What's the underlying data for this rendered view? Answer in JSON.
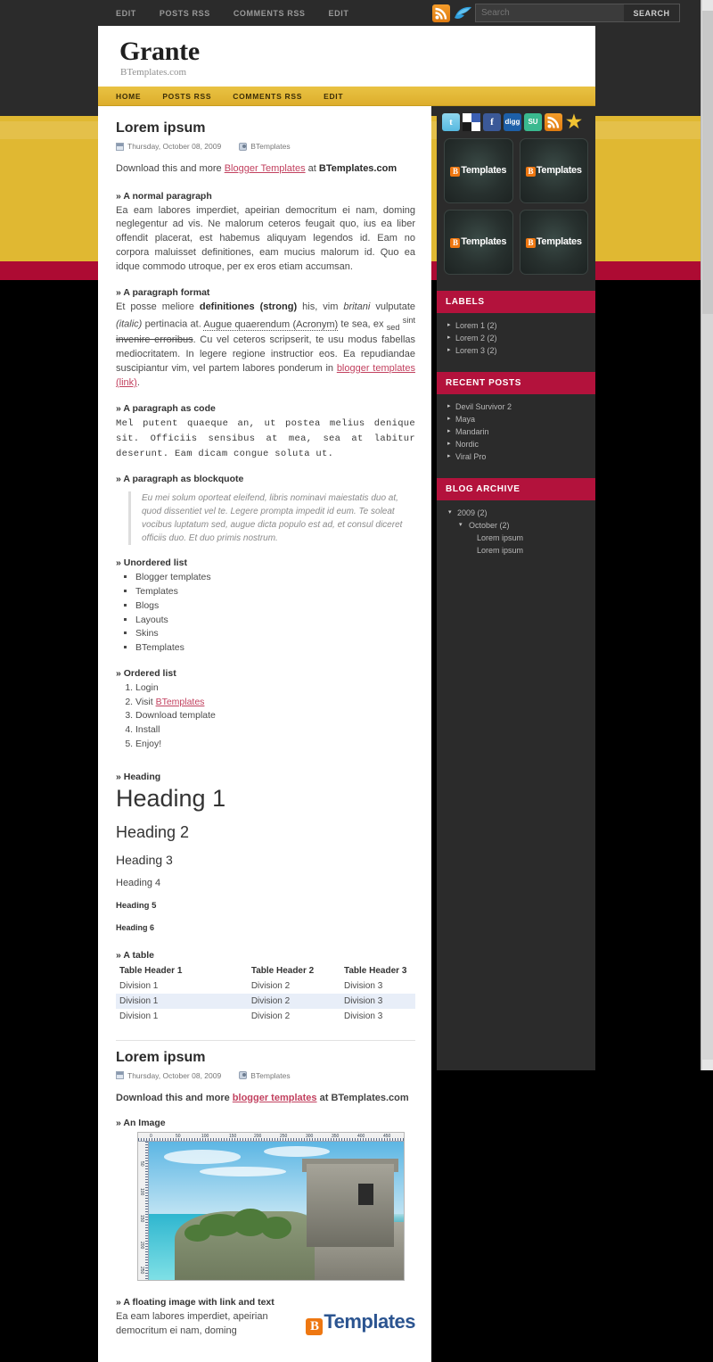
{
  "topbar": {
    "nav": [
      {
        "label": "EDIT"
      },
      {
        "label": "POSTS RSS"
      },
      {
        "label": "COMMENTS RSS"
      },
      {
        "label": "EDIT"
      }
    ],
    "icons": [
      {
        "name": "rss-icon"
      },
      {
        "name": "twitter-bird-icon"
      }
    ],
    "search": {
      "value": "",
      "placeholder": "Search",
      "button": "SEARCH"
    }
  },
  "header": {
    "title": "Grante",
    "description": "BTemplates.com"
  },
  "mainnav": [
    {
      "label": "HOME"
    },
    {
      "label": "POSTS RSS"
    },
    {
      "label": "COMMENTS RSS"
    },
    {
      "label": "EDIT"
    }
  ],
  "post1": {
    "title": "Lorem ipsum",
    "date": "Thursday, October 08, 2009",
    "author": "BTemplates",
    "download_pre": "Download this and more ",
    "download_link": "Blogger Templates",
    "download_mid": " at ",
    "download_site": "BTemplates.com",
    "normal_heading": "» A normal paragraph",
    "normal_text": "Ea eam labores imperdiet, apeirian democritum ei nam, doming neglegentur ad vis. Ne malorum ceteros feugait quo, ius ea liber offendit placerat, est habemus aliquyam legendos id. Eam no corpora maluisset definitiones, eam mucius malorum id. Quo ea idque commodo utroque, per ex eros etiam accumsan.",
    "format_heading": "» A paragraph format",
    "format_t1": "Et posse meliore ",
    "format_strong": "definitiones (strong)",
    "format_t2": " his, vim ",
    "format_italic1": "britani",
    "format_t3": " vulputate ",
    "format_italic2": "(italic)",
    "format_t4": " pertinacia at. ",
    "format_acronym": "Augue quaerendum (Acronym)",
    "format_t5": " te sea, ex ",
    "format_sub": "sed",
    "format_sup": "sint",
    "format_strike": "invenire erroribus",
    "format_t6": ". Cu vel ceteros scripserit, te usu modus fabellas mediocritatem. In legere regione instructior eos. Ea repudiandae suscipiantur vim, vel partem labores ponderum in ",
    "format_link": "blogger templates (link)",
    "format_t7": ".",
    "code_heading": "» A paragraph as code",
    "code_text": "Mel putent quaeque an, ut postea melius denique sit. Officiis sensibus at mea, sea at labitur deserunt. Eam dicam congue soluta ut.",
    "quote_heading": "» A paragraph as blockquote",
    "quote_text": "Eu mei solum oporteat eleifend, libris nominavi maiestatis duo at, quod dissentiet vel te. Legere prompta impedit id eum. Te soleat vocibus luptatum sed, augue dicta populo est ad, et consul diceret officiis duo. Et duo primis nostrum.",
    "ul_heading": "» Unordered list",
    "ul_items": [
      "Blogger templates",
      "Templates",
      "Blogs",
      "Layouts",
      "Skins",
      "BTemplates"
    ],
    "ol_heading": "» Ordered list",
    "ol_items": [
      "Login",
      "Visit BTemplates",
      "Download template",
      "Install",
      "Enjoy!"
    ],
    "ol_link_text": "BTemplates",
    "heading_label": "» Heading",
    "h1": "Heading 1",
    "h2": "Heading 2",
    "h3": "Heading 3",
    "h4": "Heading 4",
    "h5": "Heading 5",
    "h6": "Heading 6",
    "table_heading": "» A table",
    "table_headers": [
      "Table Header 1",
      "Table Header 2",
      "Table Header 3"
    ],
    "table_rows": [
      [
        "Division 1",
        "Division 2",
        "Division 3"
      ],
      [
        "Division 1",
        "Division 2",
        "Division 3"
      ],
      [
        "Division 1",
        "Division 2",
        "Division 3"
      ]
    ]
  },
  "post2": {
    "title": "Lorem ipsum",
    "date": "Thursday, October 08, 2009",
    "author": "BTemplates",
    "download_pre": "Download this and more ",
    "download_link": "blogger templates",
    "download_mid": " at ",
    "download_site": "BTemplates.com",
    "image_heading": "» An Image",
    "ruler_labels": [
      "0",
      "50",
      "100",
      "150",
      "200",
      "250",
      "300",
      "350",
      "400",
      "450"
    ],
    "ruler_v_labels": [
      "50",
      "100",
      "150",
      "200",
      "250"
    ],
    "float_heading": "» A floating image with link and text",
    "float_text": "Ea eam labores imperdiet, apeirian democritum ei nam, doming",
    "logo_text": "Templates",
    "logo_mark": "B"
  },
  "sidebar": {
    "social": [
      {
        "name": "twitter-icon",
        "glyph": "t"
      },
      {
        "name": "delicious-icon",
        "glyph": ""
      },
      {
        "name": "facebook-icon",
        "glyph": "f"
      },
      {
        "name": "digg-icon",
        "glyph": "digg"
      },
      {
        "name": "stumbleupon-icon",
        "glyph": "SU"
      },
      {
        "name": "rss-icon",
        "glyph": ""
      },
      {
        "name": "favorites-star-icon",
        "glyph": "★"
      }
    ],
    "thumbnails": [
      {
        "mark": "B",
        "label": "Templates"
      },
      {
        "mark": "B",
        "label": "Templates"
      },
      {
        "mark": "B",
        "label": "Templates"
      },
      {
        "mark": "B",
        "label": "Templates"
      }
    ],
    "widgets": [
      {
        "title": "LABELS",
        "items": [
          {
            "label": "Lorem 1 (2)"
          },
          {
            "label": "Lorem 2 (2)"
          },
          {
            "label": "Lorem 3 (2)"
          }
        ]
      },
      {
        "title": "RECENT POSTS",
        "items": [
          {
            "label": "Devil Survivor 2"
          },
          {
            "label": "Maya"
          },
          {
            "label": "Mandarin"
          },
          {
            "label": "Nordic"
          },
          {
            "label": "Viral Pro"
          }
        ]
      }
    ],
    "archive": {
      "title": "BLOG ARCHIVE",
      "items": [
        {
          "label": "2009 (2)",
          "level": 1
        },
        {
          "label": "October (2)",
          "level": 2
        },
        {
          "label": "Lorem ipsum",
          "level": 3
        },
        {
          "label": "Lorem ipsum",
          "level": 3
        }
      ]
    }
  },
  "colors": {
    "accent_yellow": "#e0b832",
    "accent_crimson": "#b3123c",
    "dark": "#2b2b2b",
    "link_pink": "#c2415f",
    "logo_orange": "#ee7711",
    "logo_blue": "#2b5490"
  }
}
